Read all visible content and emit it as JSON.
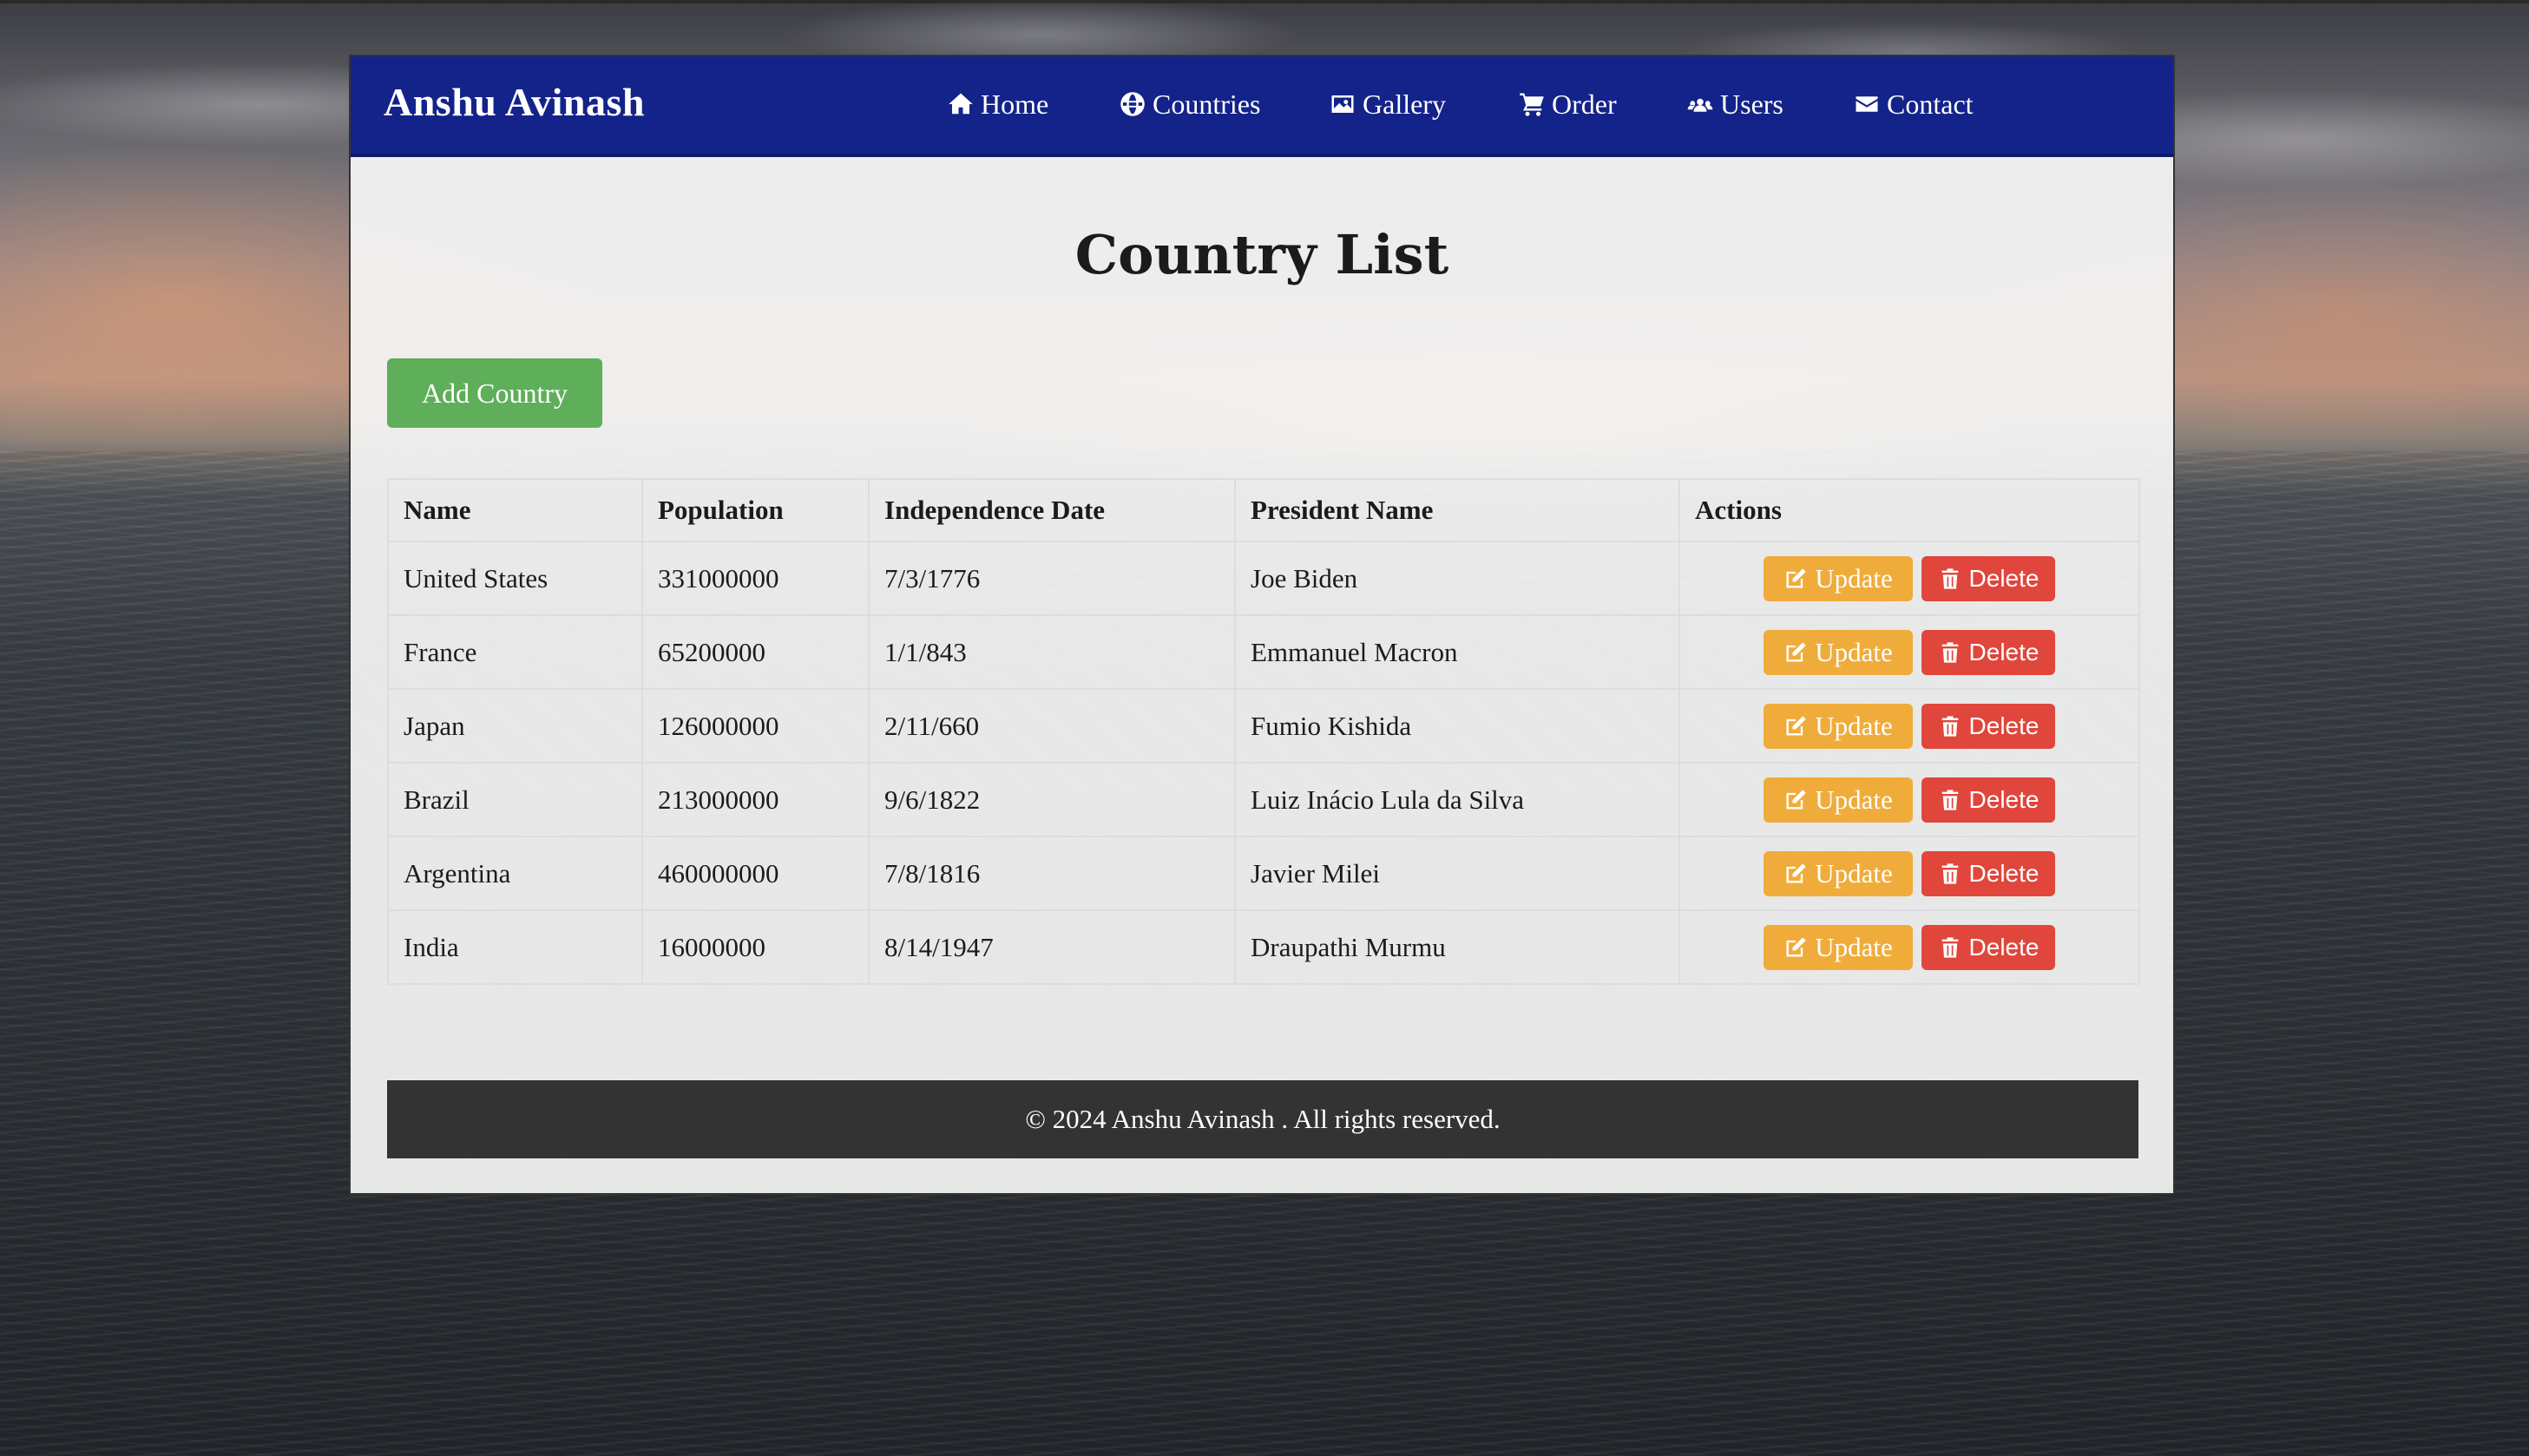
{
  "brand": "Anshu Avinash",
  "nav": [
    {
      "label": "Home",
      "icon": "home-icon"
    },
    {
      "label": "Countries",
      "icon": "globe-icon"
    },
    {
      "label": "Gallery",
      "icon": "image-icon"
    },
    {
      "label": "Order",
      "icon": "cart-icon"
    },
    {
      "label": "Users",
      "icon": "users-icon"
    },
    {
      "label": "Contact",
      "icon": "envelope-icon"
    }
  ],
  "page": {
    "title": "Country List",
    "add_button": "Add Country"
  },
  "table": {
    "headers": [
      "Name",
      "Population",
      "Independence Date",
      "President Name",
      "Actions"
    ],
    "rows": [
      {
        "name": "United States",
        "population": "331000000",
        "independence": "7/3/1776",
        "president": "Joe Biden"
      },
      {
        "name": "France",
        "population": "65200000",
        "independence": "1/1/843",
        "president": "Emmanuel Macron"
      },
      {
        "name": "Japan",
        "population": "126000000",
        "independence": "2/11/660",
        "president": "Fumio Kishida"
      },
      {
        "name": "Brazil",
        "population": "213000000",
        "independence": "9/6/1822",
        "president": "Luiz Inácio Lula da Silva"
      },
      {
        "name": "Argentina",
        "population": "460000000",
        "independence": "7/8/1816",
        "president": "Javier Milei"
      },
      {
        "name": "India",
        "population": "16000000",
        "independence": "8/14/1947",
        "president": "Draupathi Murmu"
      }
    ],
    "update_label": "Update",
    "delete_label": "Delete"
  },
  "footer": "© 2024 Anshu Avinash . All rights reserved.",
  "colors": {
    "navbar": "#14238a",
    "add_button": "#5fae5a",
    "update_button": "#f0ac3b",
    "delete_button": "#e0463c",
    "footer": "#333333"
  }
}
